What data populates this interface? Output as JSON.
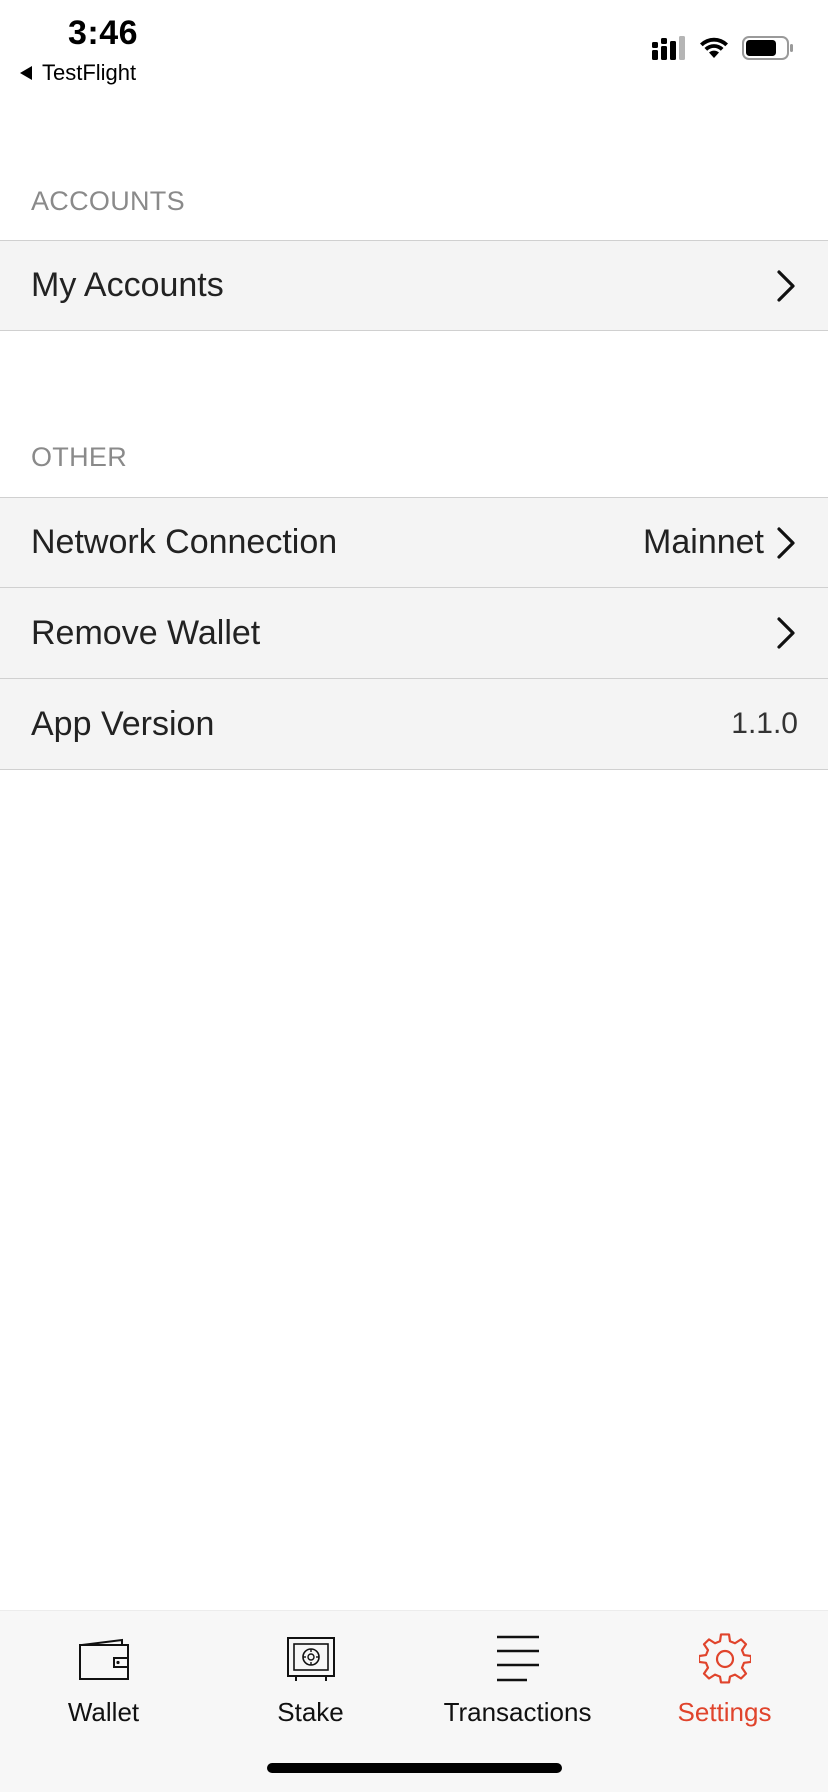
{
  "status_bar": {
    "time": "3:46",
    "back_label": "TestFlight"
  },
  "sections": {
    "accounts": {
      "header": "ACCOUNTS",
      "my_accounts": "My Accounts"
    },
    "other": {
      "header": "OTHER",
      "network_connection": "Network Connection",
      "network_value": "Mainnet",
      "remove_wallet": "Remove Wallet",
      "app_version": "App Version",
      "app_version_value": "1.1.0"
    }
  },
  "tabs": [
    {
      "label": "Wallet",
      "icon": "wallet-icon",
      "active": false
    },
    {
      "label": "Stake",
      "icon": "safe-icon",
      "active": false
    },
    {
      "label": "Transactions",
      "icon": "list-icon",
      "active": false
    },
    {
      "label": "Settings",
      "icon": "gear-icon",
      "active": true
    }
  ],
  "colors": {
    "accent": "#e0442c",
    "row_background": "#f4f4f4",
    "section_header": "#8a8a8a"
  }
}
